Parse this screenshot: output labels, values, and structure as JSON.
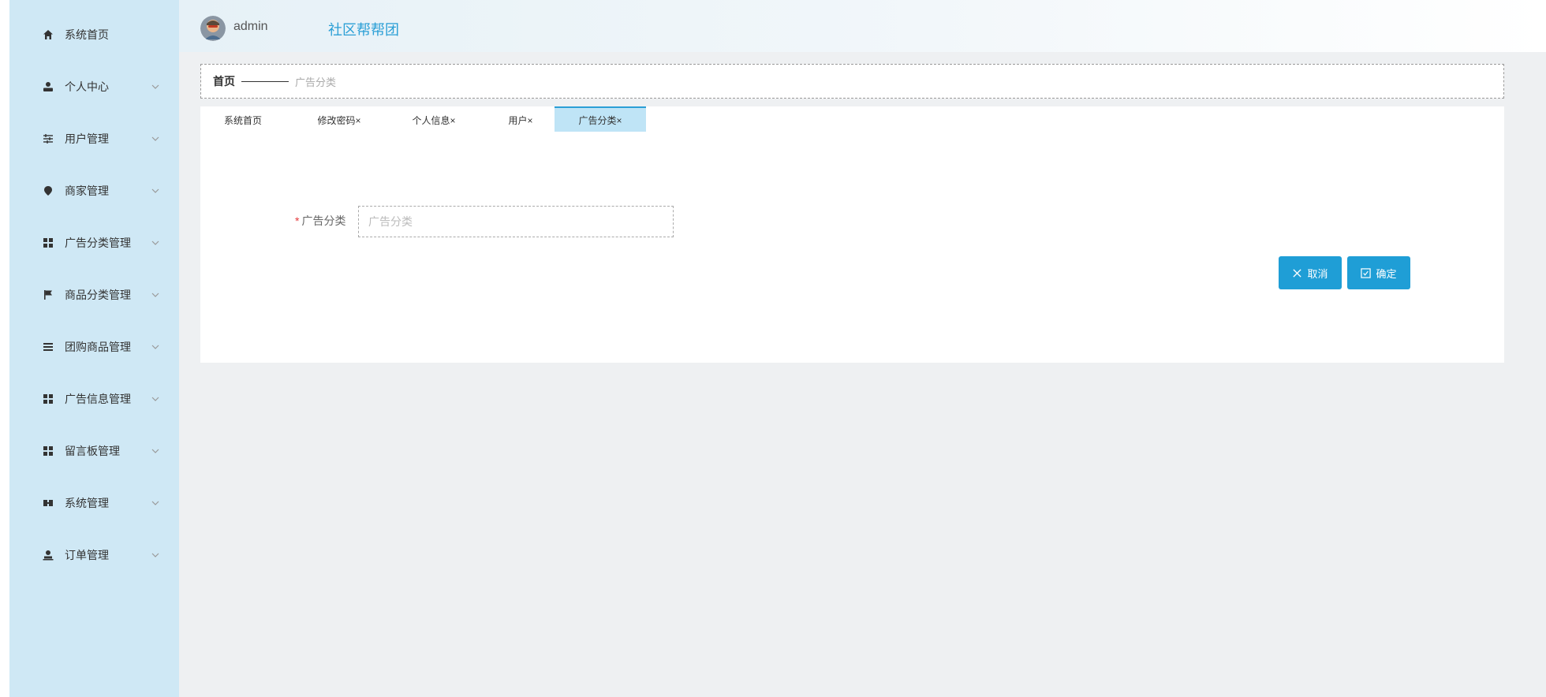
{
  "header": {
    "username": "admin",
    "site_title": "社区帮帮团"
  },
  "sidebar": {
    "items": [
      {
        "label": "系统首页",
        "icon": "home-icon"
      },
      {
        "label": "个人中心",
        "icon": "user-icon"
      },
      {
        "label": "用户管理",
        "icon": "sliders-icon"
      },
      {
        "label": "商家管理",
        "icon": "location-pin-icon"
      },
      {
        "label": "广告分类管理",
        "icon": "grid-icon"
      },
      {
        "label": "商品分类管理",
        "icon": "flag-icon"
      },
      {
        "label": "团购商品管理",
        "icon": "list-icon"
      },
      {
        "label": "广告信息管理",
        "icon": "grid-icon"
      },
      {
        "label": "留言板管理",
        "icon": "grid-icon"
      },
      {
        "label": "系统管理",
        "icon": "settings-icon"
      },
      {
        "label": "订单管理",
        "icon": "user-upload-icon"
      }
    ]
  },
  "breadcrumb": {
    "home": "首页",
    "current": "广告分类"
  },
  "tabs": [
    {
      "label": "系统首页"
    },
    {
      "label": "修改密码×"
    },
    {
      "label": "个人信息×"
    },
    {
      "label": "用户×"
    },
    {
      "label": "广告分类×"
    }
  ],
  "form": {
    "required_mark": "*",
    "field_label": "广告分类",
    "field_placeholder": "广告分类",
    "field_value": ""
  },
  "buttons": {
    "cancel": "取消",
    "confirm": "确定"
  },
  "colors": {
    "sidebar_bg": "#cfe8f5",
    "accent": "#1f9ed6",
    "active_tab": "#bfe4f6"
  }
}
